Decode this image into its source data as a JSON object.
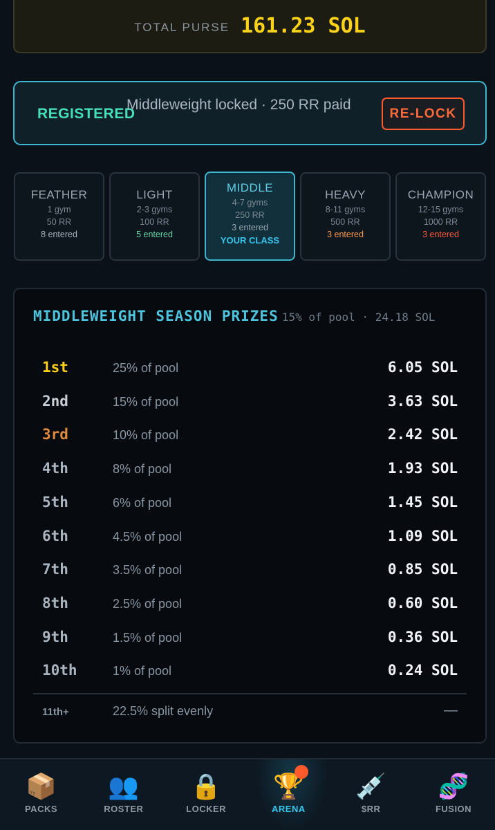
{
  "purse": {
    "label": "TOTAL PURSE",
    "value": "161.23 SOL"
  },
  "registration": {
    "status": "REGISTERED",
    "details": "Middleweight locked · 250 RR paid",
    "relock_label": "RE-LOCK"
  },
  "classes": [
    {
      "name": "FEATHER",
      "gyms": "1 gym",
      "rr": "50 RR",
      "entered": "8 entered",
      "entered_color": "#aab4be"
    },
    {
      "name": "LIGHT",
      "gyms": "2-3 gyms",
      "rr": "100 RR",
      "entered": "5 entered",
      "entered_color": "#66d9a8"
    },
    {
      "name": "MIDDLE",
      "gyms": "4-7 gyms",
      "rr": "250 RR",
      "entered": "3 entered",
      "entered_color": "#9aa5b1",
      "badge": "YOUR CLASS"
    },
    {
      "name": "HEAVY",
      "gyms": "8-11 gyms",
      "rr": "500 RR",
      "entered": "3 entered",
      "entered_color": "#ff9a4d"
    },
    {
      "name": "CHAMPION",
      "gyms": "12-15 gyms",
      "rr": "1000 RR",
      "entered": "3 entered",
      "entered_color": "#ff5a3c"
    }
  ],
  "prizes": {
    "title": "MIDDLEWEIGHT SEASON PRIZES",
    "subtitle": "15% of pool · 24.18 SOL",
    "rows": [
      {
        "rank": "1st",
        "pct": "25% of pool",
        "amount": "6.05 SOL",
        "rank_color": "#ffd21a"
      },
      {
        "rank": "2nd",
        "pct": "15% of pool",
        "amount": "3.63 SOL",
        "rank_color": "#c9d0d8"
      },
      {
        "rank": "3rd",
        "pct": "10% of pool",
        "amount": "2.42 SOL",
        "rank_color": "#e08a3c"
      },
      {
        "rank": "4th",
        "pct": "8% of pool",
        "amount": "1.93 SOL",
        "rank_color": "#aab4be"
      },
      {
        "rank": "5th",
        "pct": "6% of pool",
        "amount": "1.45 SOL",
        "rank_color": "#aab4be"
      },
      {
        "rank": "6th",
        "pct": "4.5% of pool",
        "amount": "1.09 SOL",
        "rank_color": "#aab4be"
      },
      {
        "rank": "7th",
        "pct": "3.5% of pool",
        "amount": "0.85 SOL",
        "rank_color": "#aab4be"
      },
      {
        "rank": "8th",
        "pct": "2.5% of pool",
        "amount": "0.60 SOL",
        "rank_color": "#aab4be"
      },
      {
        "rank": "9th",
        "pct": "1.5% of pool",
        "amount": "0.36 SOL",
        "rank_color": "#aab4be"
      },
      {
        "rank": "10th",
        "pct": "1% of pool",
        "amount": "0.24 SOL",
        "rank_color": "#aab4be"
      }
    ],
    "rest": {
      "rank": "11th+",
      "pct": "22.5% split evenly",
      "amount": "—"
    }
  },
  "nav": [
    {
      "label": "PACKS",
      "icon": "📦",
      "icon_name": "package-icon"
    },
    {
      "label": "ROSTER",
      "icon": "👥",
      "icon_name": "people-icon"
    },
    {
      "label": "LOCKER",
      "icon": "🔒",
      "icon_name": "lock-icon"
    },
    {
      "label": "ARENA",
      "icon": "🏆",
      "icon_name": "trophy-icon",
      "active": true
    },
    {
      "label": "$RR",
      "icon": "💉",
      "icon_name": "syringe-icon"
    },
    {
      "label": "FUSION",
      "icon": "🧬",
      "icon_name": "dna-icon"
    }
  ],
  "colors": {
    "accent": "#3fb6d0",
    "gold": "#ffd21a",
    "warning": "#ff5a2c"
  }
}
